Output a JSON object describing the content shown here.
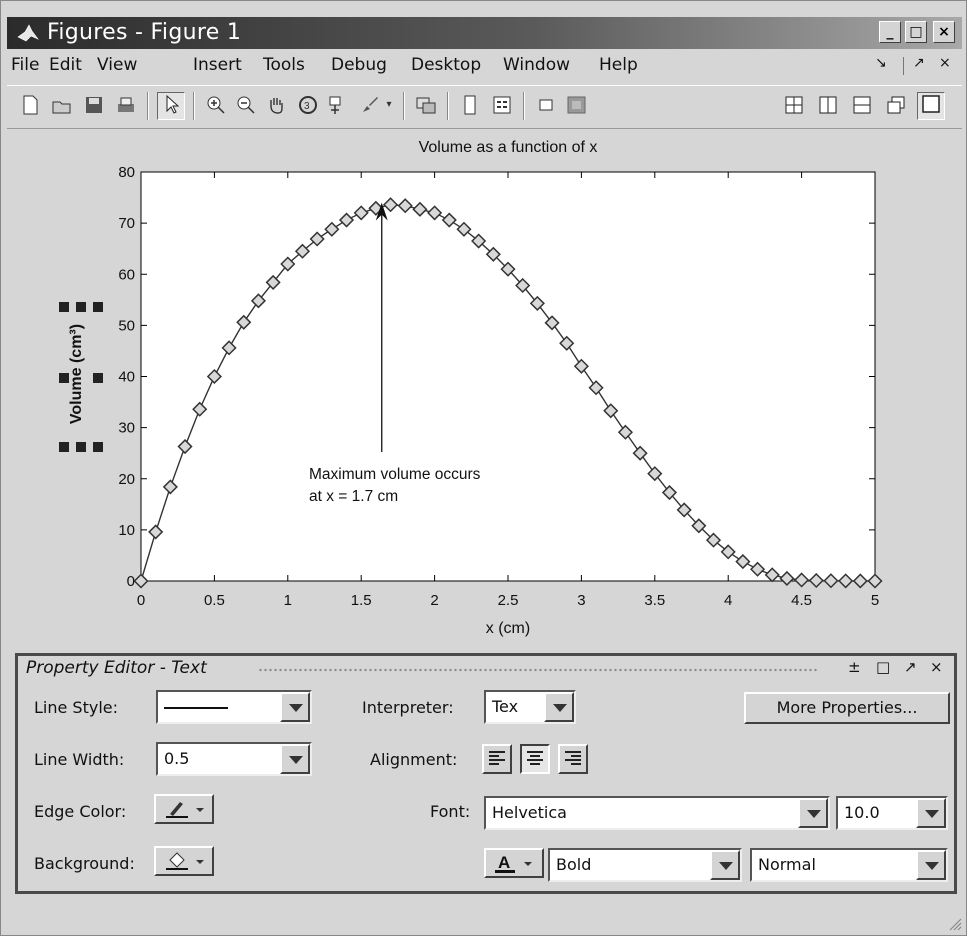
{
  "window": {
    "title": "Figures - Figure 1",
    "controls": {
      "minimize": "_",
      "maximize": "□",
      "close": "×"
    }
  },
  "menubar": {
    "items": [
      "File",
      "Edit",
      "View",
      "Insert",
      "Tools",
      "Debug",
      "Desktop",
      "Window",
      "Help"
    ],
    "right_controls": [
      "↘",
      "↗",
      "×"
    ]
  },
  "toolbar": {
    "icons": [
      "new-figure-icon",
      "open-file-icon",
      "save-icon",
      "print-icon",
      "select-arrow-icon",
      "zoom-in-icon",
      "zoom-out-icon",
      "pan-hand-icon",
      "rotate-3d-icon",
      "data-cursor-icon",
      "brush-icon",
      "link-plot-icon",
      "colorbar-icon",
      "legend-icon",
      "hide-plot-tools-icon",
      "show-plot-tools-icon",
      "tile-grid-icon",
      "tile-columns-icon",
      "tile-rows-icon",
      "float-icon",
      "maximize-icon"
    ]
  },
  "chart_data": {
    "type": "line",
    "title": "Volume as a function of x",
    "xlabel": "x (cm)",
    "ylabel": "Volume (cm³)",
    "xlim": [
      0,
      5
    ],
    "ylim": [
      0,
      80
    ],
    "xticks": [
      "0",
      "0.5",
      "1",
      "1.5",
      "2",
      "2.5",
      "3",
      "3.5",
      "4",
      "4.5",
      "5"
    ],
    "yticks": [
      "0",
      "10",
      "20",
      "30",
      "40",
      "50",
      "60",
      "70",
      "80"
    ],
    "marker": "diamond",
    "grid": false,
    "series": [
      {
        "x": [
          0,
          0.1,
          0.2,
          0.3,
          0.4,
          0.5,
          0.6,
          0.7,
          0.8,
          0.9,
          1.0,
          1.1,
          1.2,
          1.3,
          1.4,
          1.5,
          1.6,
          1.7,
          1.8,
          1.9,
          2.0,
          2.1,
          2.2,
          2.3,
          2.4,
          2.5,
          2.6,
          2.7,
          2.8,
          2.9,
          3.0,
          3.1,
          3.2,
          3.3,
          3.4,
          3.5,
          3.6,
          3.7,
          3.8,
          3.9,
          4.0,
          4.1,
          4.2,
          4.3,
          4.4,
          4.5,
          4.6,
          4.7,
          4.8,
          4.9,
          5.0
        ],
        "y": [
          0,
          9.6,
          18.4,
          26.3,
          33.6,
          40,
          45.6,
          50.6,
          54.8,
          58.4,
          62,
          64.5,
          66.9,
          68.8,
          70.6,
          72,
          72.9,
          73.6,
          73.4,
          72.7,
          72,
          70.6,
          68.8,
          66.5,
          63.9,
          61,
          57.8,
          54.3,
          50.5,
          46.5,
          42,
          37.8,
          33.3,
          29.1,
          25,
          21,
          17.3,
          13.9,
          10.8,
          8,
          5.7,
          3.8,
          2.3,
          1.2,
          0.5,
          0.2,
          0.1,
          0.05,
          0.02,
          0.01,
          0
        ]
      }
    ],
    "annotation": {
      "lines": [
        "Maximum volume occurs",
        "at x = 1.7 cm"
      ],
      "arrow_to": [
        1.64,
        74
      ]
    }
  },
  "property_editor": {
    "title": "Property Editor - Text",
    "head_controls": [
      "±",
      "□",
      "↗",
      "×"
    ],
    "line_style_label": "Line Style:",
    "line_width_label": "Line Width:",
    "line_width_value": "0.5",
    "edge_color_label": "Edge Color:",
    "background_label": "Background:",
    "interpreter_label": "Interpreter:",
    "interpreter_value": "Tex",
    "alignment_label": "Alignment:",
    "font_label": "Font:",
    "font_value": "Helvetica",
    "font_size_value": "10.0",
    "font_weight_value": "Bold",
    "font_angle_value": "Normal",
    "more_properties_label": "More Properties..."
  }
}
